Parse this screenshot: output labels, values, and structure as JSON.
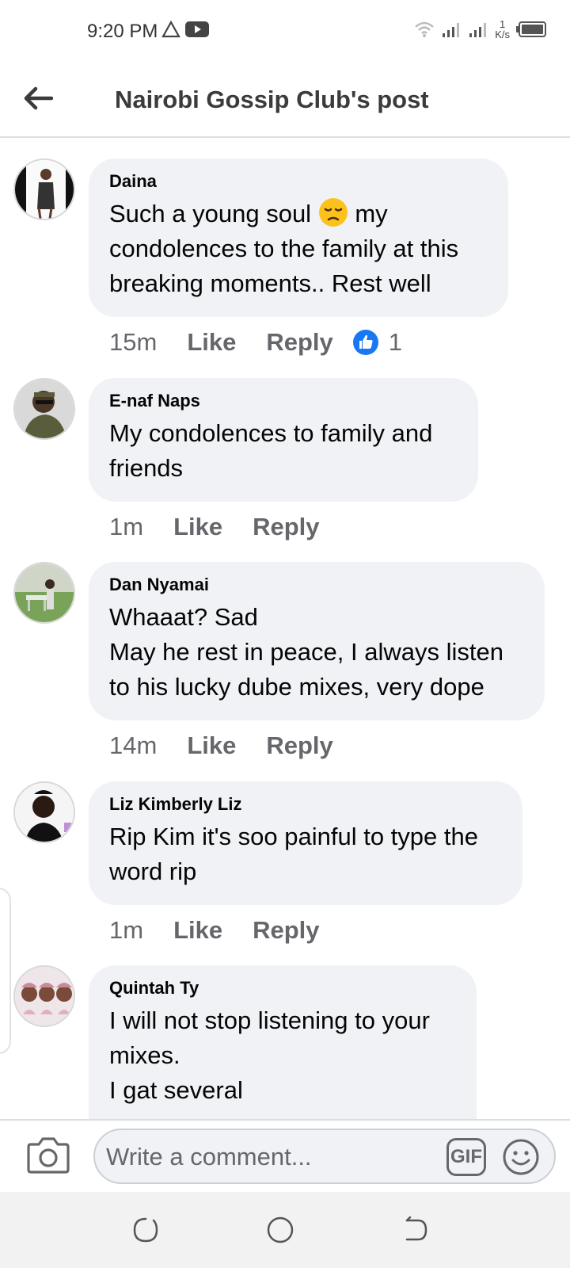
{
  "status_bar": {
    "time": "9:20 PM",
    "speed_value": "1",
    "speed_unit": "K/s"
  },
  "header": {
    "title": "Nairobi Gossip Club's post",
    "back_icon": "arrow-left-icon"
  },
  "comments": [
    {
      "author": "Daina",
      "text": "Such a young soul",
      "text_after_emoji": " my condolences to the family at this breaking moments.. Rest well",
      "emoji": "pensive-face-icon",
      "time": "15m",
      "like_label": "Like",
      "reply_label": "Reply",
      "reaction_count": "1"
    },
    {
      "author": "E-naf Naps",
      "text": "My condolences to family and\nfriends",
      "time": "1m",
      "like_label": "Like",
      "reply_label": "Reply"
    },
    {
      "author": "Dan Nyamai",
      "text": "Whaaat? Sad\nMay he rest in peace, I always listen\nto his lucky dube mixes, very dope",
      "time": "14m",
      "like_label": "Like",
      "reply_label": "Reply"
    },
    {
      "author": "Liz Kimberly Liz",
      "text": "Rip Kim it's soo painful to type the\nword rip",
      "time": "1m",
      "like_label": "Like",
      "reply_label": "Reply"
    },
    {
      "author": "Quintah Ty",
      "text": "I will not stop listening to your\nmixes.\nI gat several"
    }
  ],
  "composer": {
    "placeholder": "Write a comment...",
    "gif_label": "GIF"
  },
  "colors": {
    "bubble_bg": "#f0f2f5",
    "secondary_text": "#65676b",
    "like_blue": "#1877f2"
  }
}
